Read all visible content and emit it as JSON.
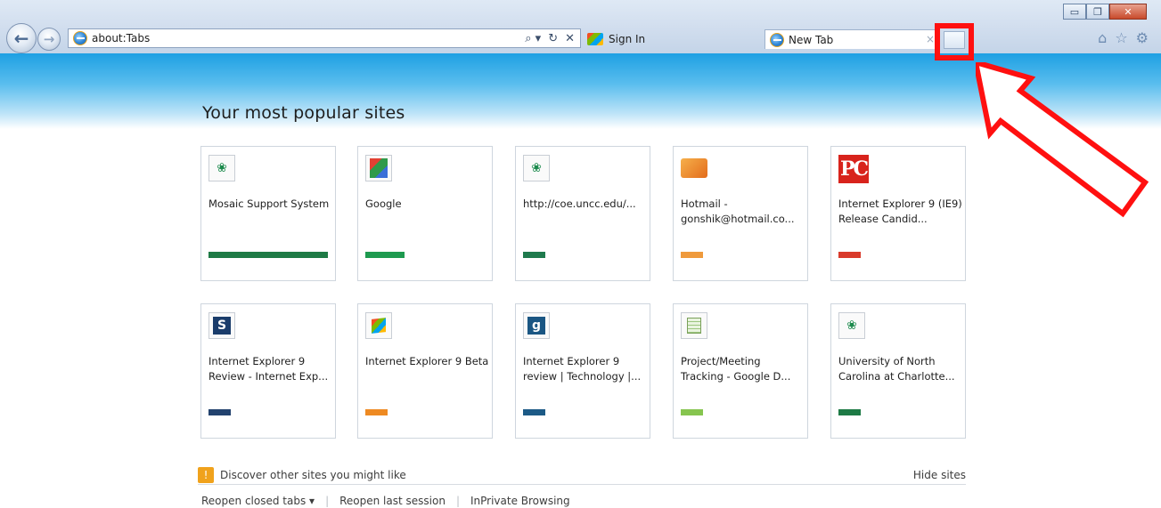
{
  "browser": {
    "address_url": "about:Tabs",
    "address_tools": {
      "search": "⌕ ▾",
      "refresh": "↻",
      "stop": "✕"
    },
    "tabs": [
      {
        "label": "Sign In",
        "active": false
      },
      {
        "label": "New Tab",
        "active": true
      }
    ],
    "tab_close_glyph": "×",
    "window_buttons": {
      "minimize": "▭",
      "restore": "❐",
      "close": "✕"
    },
    "command_icons": {
      "home": "⌂",
      "favorites": "☆",
      "tools": "⚙"
    },
    "nav": {
      "back": "←",
      "forward": "→"
    }
  },
  "page": {
    "heading": "Your most popular sites",
    "tiles": [
      {
        "title": "Mosaic Support System",
        "icon": "lotus-icon",
        "bar_color": "#1e7a45",
        "activity": 1.0
      },
      {
        "title": "Google",
        "icon": "google-icon",
        "bar_color": "#1e9a4f",
        "activity": 0.33
      },
      {
        "title": "http://coe.uncc.edu/...",
        "icon": "lotus-icon",
        "bar_color": "#1f7a4d",
        "activity": 0.19
      },
      {
        "title": "Hotmail - gonshik@hotmail.co...",
        "icon": "mail-icon",
        "bar_color": "#ef9a3c",
        "activity": 0.19
      },
      {
        "title": "Internet Explorer 9 (IE9) Release Candid...",
        "icon": "pc-magazine-icon",
        "bar_color": "#d93a2b",
        "activity": 0.19
      },
      {
        "title": "Internet Explorer 9 Review - Internet Exp...",
        "icon": "s-icon",
        "bar_color": "#22426e",
        "activity": 0.19
      },
      {
        "title": "Internet Explorer 9 Beta",
        "icon": "windows-icon",
        "bar_color": "#ee8a22",
        "activity": 0.19
      },
      {
        "title": "Internet Explorer 9 review | Technology |...",
        "icon": "g-icon",
        "bar_color": "#1c5a86",
        "activity": 0.19
      },
      {
        "title": "Project/Meeting Tracking - Google D...",
        "icon": "spreadsheet-icon",
        "bar_color": "#86c54f",
        "activity": 0.19
      },
      {
        "title": "University of North Carolina at Charlotte...",
        "icon": "lotus-icon",
        "bar_color": "#1d7a45",
        "activity": 0.19
      }
    ],
    "tile_glyphs": {
      "lotus": "❀",
      "pc": "PC",
      "s": "S",
      "g": "g"
    },
    "discover": {
      "bulb": "!",
      "label": "Discover other sites you might like",
      "hide": "Hide sites"
    },
    "bottom_links": {
      "reopen_closed": "Reopen closed tabs ▾",
      "reopen_session": "Reopen last session",
      "inprivate": "InPrivate Browsing",
      "separator": "|"
    }
  },
  "annotation": {
    "highlight_color": "#ff1010",
    "arrow_color": "#ff1010"
  }
}
